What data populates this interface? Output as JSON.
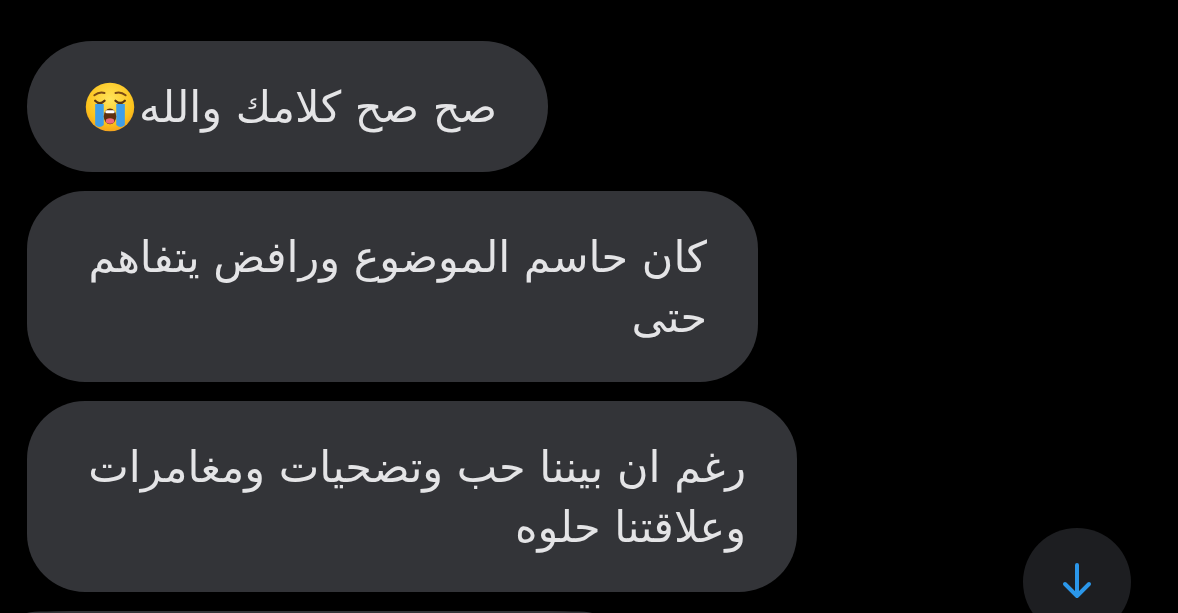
{
  "messages": [
    {
      "text": "صح صح كلامك والله",
      "emoji_icon": true
    },
    {
      "text": "كان حاسم الموضوع ورافض يتفاهم حتى",
      "emoji_icon": false
    },
    {
      "text": "رغم ان بيننا حب وتضحيات ومغامرات وعلاقتنا حلوه",
      "emoji_icon": false
    }
  ],
  "next_message_peek": true
}
